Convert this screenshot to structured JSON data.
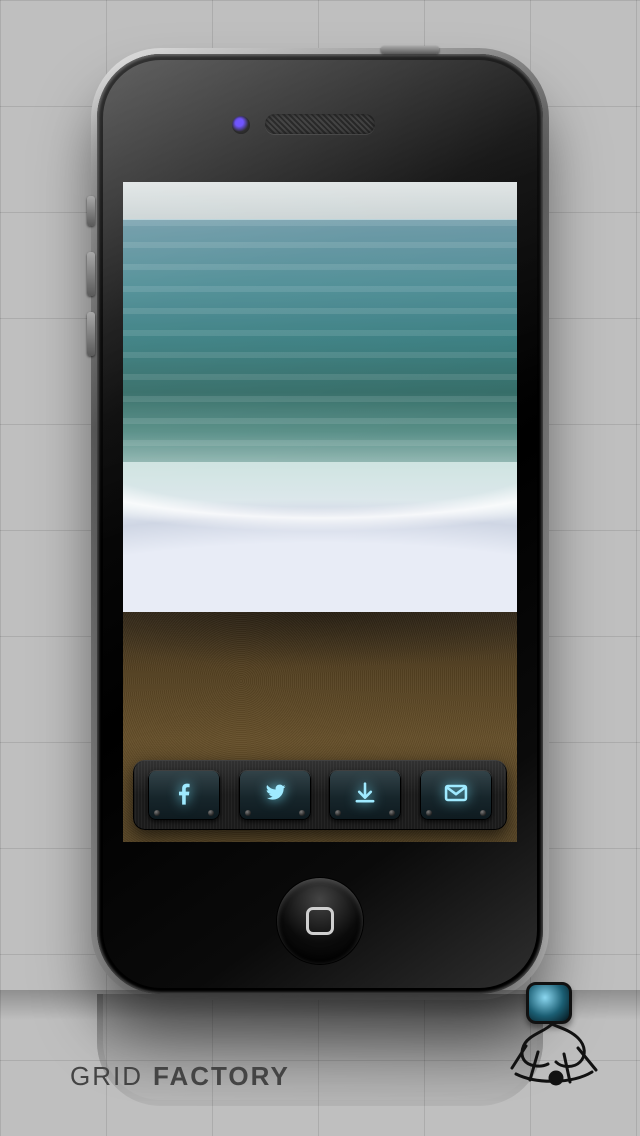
{
  "brand": {
    "word1": "GRID",
    "word2": "FACTORY"
  },
  "toolbar": {
    "buttons": [
      {
        "name": "facebook-share-button",
        "icon": "facebook-icon"
      },
      {
        "name": "twitter-share-button",
        "icon": "twitter-icon"
      },
      {
        "name": "download-button",
        "icon": "download-icon"
      },
      {
        "name": "email-share-button",
        "icon": "mail-icon"
      }
    ]
  },
  "device": {
    "home_button": "home-button"
  }
}
